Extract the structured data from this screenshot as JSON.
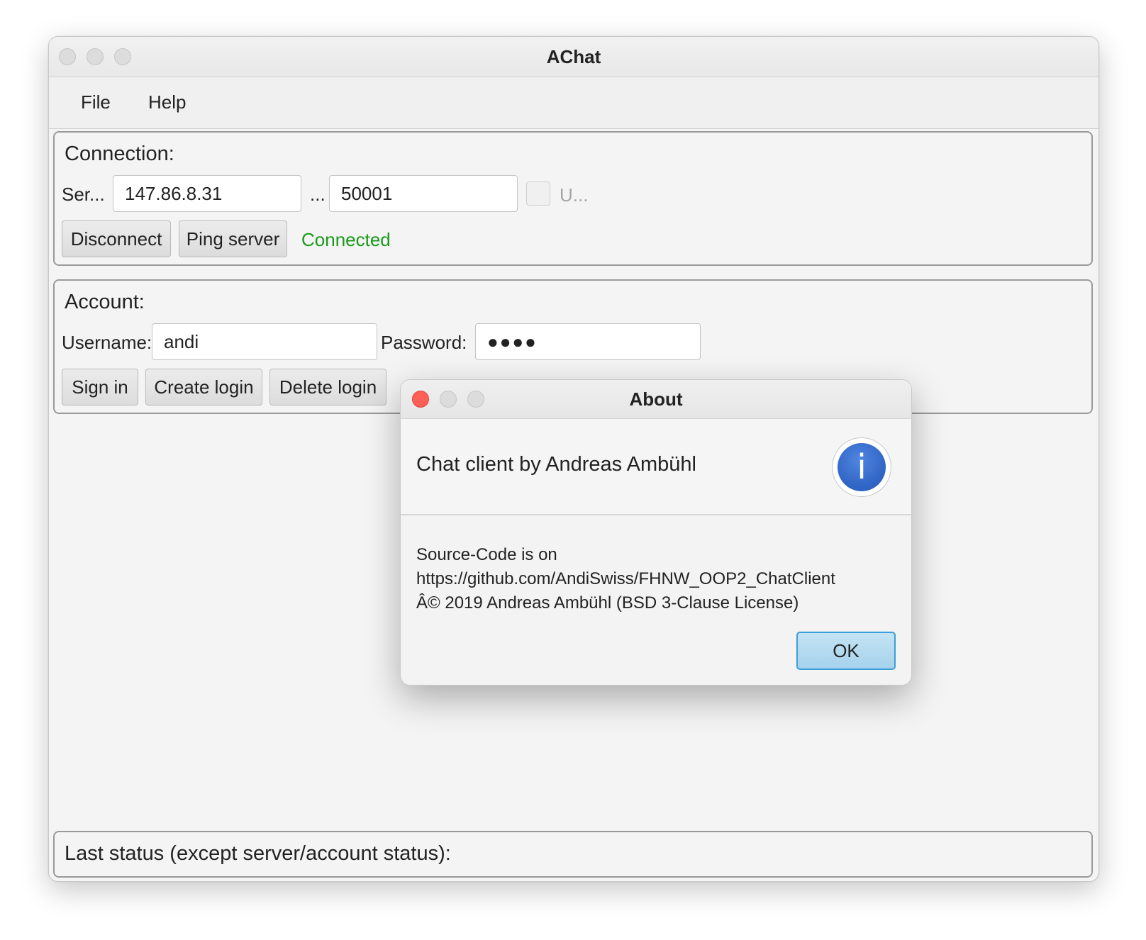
{
  "window": {
    "title": "AChat"
  },
  "menu": {
    "file": "File",
    "help": "Help"
  },
  "connection": {
    "title": "Connection:",
    "server_label": "Ser...",
    "server_value": "147.86.8.31",
    "port_label": "...",
    "port_value": "50001",
    "checkbox_label": "U...",
    "disconnect": "Disconnect",
    "ping": "Ping server",
    "status": "Connected",
    "status_color": "#1a9a1a"
  },
  "account": {
    "title": "Account:",
    "username_label": "Username:",
    "username_value": "andi",
    "password_label": "Password:",
    "password_value": "●●●●",
    "sign_in": "Sign in",
    "create_login": "Create login",
    "delete_login": "Delete login"
  },
  "status_panel": {
    "title": "Last status (except server/account status):"
  },
  "dialog": {
    "title": "About",
    "header": "Chat client by Andreas Ambühl",
    "info_icon_glyph": "i",
    "content_lines": [
      "Source-Code is on",
      "https://github.com/AndiSwiss/FHNW_OOP2_ChatClient",
      "Â© 2019 Andreas Ambühl (BSD 3-Clause License)"
    ],
    "ok": "OK"
  }
}
